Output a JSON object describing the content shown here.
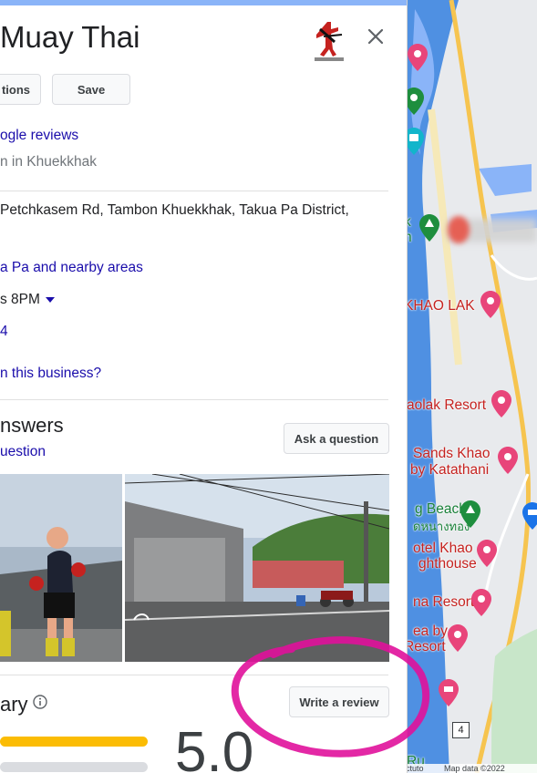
{
  "place": {
    "title": "Muay Thai"
  },
  "actions": {
    "directions_label": "tions",
    "save_label": "Save"
  },
  "reviews_link": "ogle reviews",
  "category_line": "n in Khuekkhak",
  "address": "Petchkasem Rd, Tambon Khuekkhak, Takua Pa District,",
  "service_area": "a Pa and nearby areas",
  "hours": "s 8PM",
  "phone": "4",
  "own_business": "n this business?",
  "qa": {
    "heading": "nswers",
    "sub_link": "uestion",
    "ask_label": "Ask a question"
  },
  "review_summary": {
    "heading": "ary",
    "write_label": "Write a review",
    "score": "5.0",
    "bar_fill": 1.0
  },
  "map": {
    "labels": [
      {
        "text": "KHAO LAK",
        "color": "#c5221f"
      },
      {
        "text": "aolak Resort",
        "color": "#c5221f"
      },
      {
        "text": "Sands Khao",
        "color": "#c5221f"
      },
      {
        "text": "by Katathani",
        "color": "#c5221f"
      },
      {
        "text": "g Beach",
        "color": "#188038"
      },
      {
        "text": "ดหนางทอง",
        "color": "#188038"
      },
      {
        "text": "otel Khao",
        "color": "#c5221f"
      },
      {
        "text": "ghthouse",
        "color": "#c5221f"
      },
      {
        "text": "na Resort",
        "color": "#c5221f"
      },
      {
        "text": "ea by",
        "color": "#c5221f"
      },
      {
        "text": "Resort",
        "color": "#c5221f"
      },
      {
        "text": "k",
        "color": "#188038"
      },
      {
        "text": "h",
        "color": "#188038"
      },
      {
        "text": "Ru",
        "color": "#188038"
      }
    ],
    "road_shield": "4",
    "footer": "Map data ©2022",
    "footer_left": "ctuto"
  },
  "colors": {
    "accent": "#1a0dab",
    "annotation": "#e0119b",
    "star": "#fbbc04"
  }
}
